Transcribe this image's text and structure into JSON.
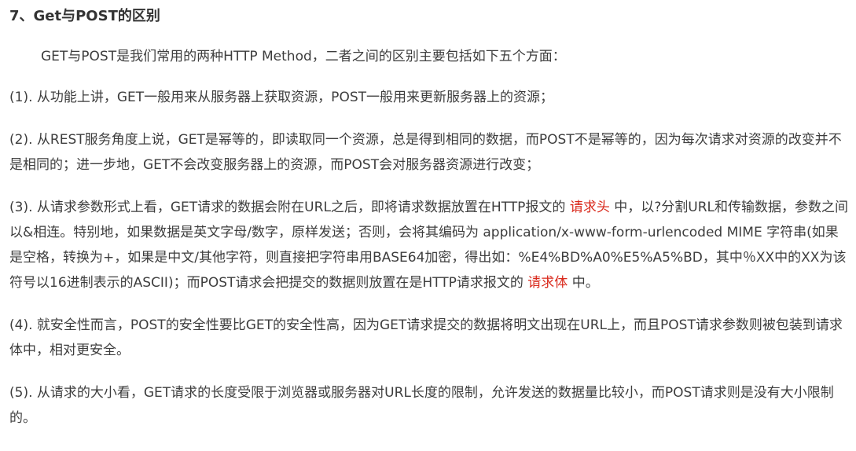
{
  "heading": "7、Get与POST的区别",
  "intro": "GET与POST是我们常用的两种HTTP Method，二者之间的区别主要包括如下五个方面：",
  "p1": "(1). 从功能上讲，GET一般用来从服务器上获取资源，POST一般用来更新服务器上的资源；",
  "p2": "(2). 从REST服务角度上说，GET是幂等的，即读取同一个资源，总是得到相同的数据，而POST不是幂等的，因为每次请求对资源的改变并不是相同的；进一步地，GET不会改变服务器上的资源，而POST会对服务器资源进行改变；",
  "p3": {
    "part1": "(3). 从请求参数形式上看，GET请求的数据会附在URL之后，即将请求数据放置在HTTP报文的 ",
    "highlight1": "请求头",
    "part2": " 中，以?分割URL和传输数据，参数之间以&相连。特别地，如果数据是英文字母/数字，原样发送；否则，会将其编码为 application/x-www-form-urlencoded MIME 字符串(如果是空格，转换为+，如果是中文/其他字符，则直接把字符串用BASE64加密，得出如：%E4%BD%A0%E5%A5%BD，其中％XX中的XX为该符号以16进制表示的ASCII)；而POST请求会把提交的数据则放置在是HTTP请求报文的 ",
    "highlight2": "请求体",
    "part3": " 中。"
  },
  "p4": "(4). 就安全性而言，POST的安全性要比GET的安全性高，因为GET请求提交的数据将明文出现在URL上，而且POST请求参数则被包装到请求体中，相对更安全。",
  "p5": "(5). 从请求的大小看，GET请求的长度受限于浏览器或服务器对URL长度的限制，允许发送的数据量比较小，而POST请求则是没有大小限制的。",
  "colors": {
    "text": "#3d3d3d",
    "highlight": "#d9281b"
  }
}
